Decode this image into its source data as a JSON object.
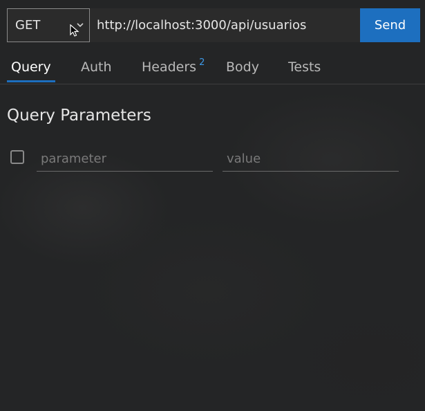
{
  "request": {
    "method": "GET",
    "url": "http://localhost:3000/api/usuarios",
    "send_label": "Send"
  },
  "tabs": [
    {
      "label": "Query",
      "active": true
    },
    {
      "label": "Auth"
    },
    {
      "label": "Headers",
      "badge": "2"
    },
    {
      "label": "Body"
    },
    {
      "label": "Tests"
    }
  ],
  "query": {
    "title": "Query Parameters",
    "parameter_placeholder": "parameter",
    "value_placeholder": "value"
  },
  "colors": {
    "accent": "#1d6fbf",
    "badge": "#3d9be9",
    "background": "#242526"
  },
  "icons": {
    "method_dropdown": "chevron-down-icon",
    "pointer": "cursor-icon"
  }
}
